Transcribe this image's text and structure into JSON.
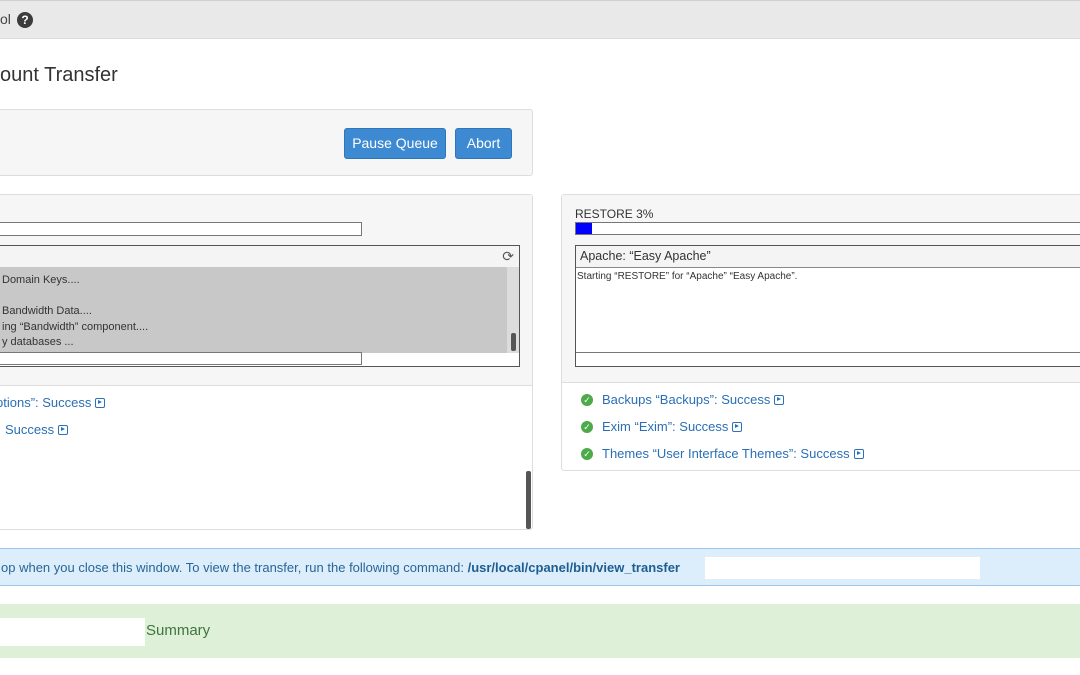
{
  "header": {
    "breadcrumb_fragment": "ol",
    "help_icon": "question-circle-icon"
  },
  "page": {
    "title": "ount Transfer"
  },
  "queue_controls": {
    "pause_label": "Pause Queue",
    "abort_label": "Abort",
    "button_color": "#3d8ad2"
  },
  "left_panel": {
    "log_lines": [
      "Domain Keys....",
      "",
      "Bandwidth Data....",
      "ing “Bandwidth” component....",
      "y databases ..."
    ],
    "refresh_icon": "refresh-icon",
    "results": [
      {
        "text": "ptions”: Success",
        "status": "success"
      },
      {
        "text": "Success",
        "status": "success"
      }
    ]
  },
  "right_panel": {
    "title": "RESTORE 3%",
    "progress_percent": 3,
    "progress_color": "#0000ff",
    "log_title": "Apache: “Easy Apache”",
    "log_lines": [
      "Starting “RESTORE” for “Apache” “Easy Apache”."
    ],
    "results": [
      {
        "text": "Backups “Backups”: Success",
        "status": "success"
      },
      {
        "text": "Exim “Exim”: Success",
        "status": "success"
      },
      {
        "text": "Themes “User Interface Themes”: Success",
        "status": "success"
      }
    ]
  },
  "info_bar": {
    "text": "op when you close this window. To view the transfer, run the following command: ",
    "command": "/usr/local/cpanel/bin/view_transfer",
    "bg_color": "#dceefb"
  },
  "summary_bar": {
    "label": "Summary",
    "bg_color": "#dff0d8"
  }
}
